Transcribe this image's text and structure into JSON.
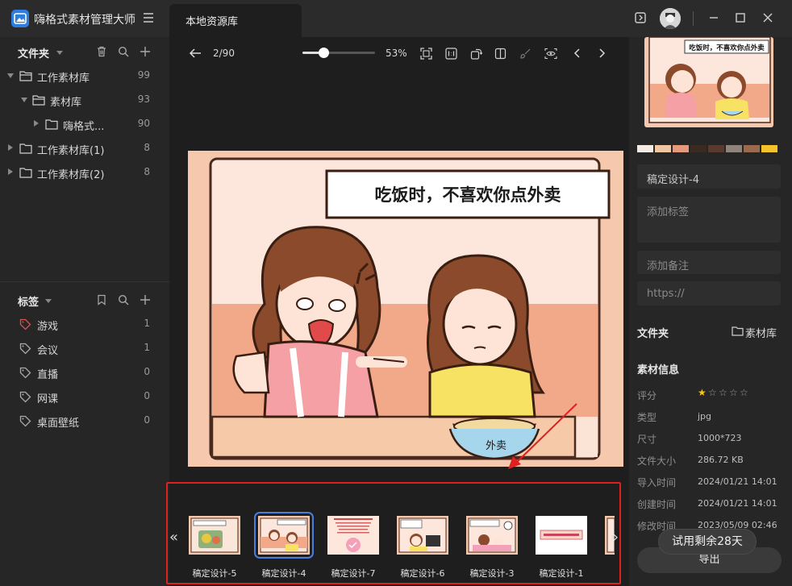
{
  "app": {
    "title": "嗨格式素材管理大师",
    "tab_label": "本地资源库"
  },
  "folders": {
    "section_title": "文件夹",
    "items": [
      {
        "label": "工作素材库",
        "count": "99"
      },
      {
        "label": "素材库",
        "count": "93"
      },
      {
        "label": "嗨格式...",
        "count": "90"
      },
      {
        "label": "工作素材库(1)",
        "count": "8"
      },
      {
        "label": "工作素材库(2)",
        "count": "8"
      }
    ]
  },
  "tags": {
    "section_title": "标签",
    "items": [
      {
        "label": "游戏",
        "count": "1",
        "color": "#e05050"
      },
      {
        "label": "会议",
        "count": "1",
        "color": "#aaaaaa"
      },
      {
        "label": "直播",
        "count": "0",
        "color": "#aaaaaa"
      },
      {
        "label": "网课",
        "count": "0",
        "color": "#aaaaaa"
      },
      {
        "label": "桌面壁纸",
        "count": "0",
        "color": "#aaaaaa"
      }
    ]
  },
  "viewer": {
    "page_indicator": "2/90",
    "zoom_label": "53%",
    "zoom_fraction": 0.53,
    "comic": {
      "caption": "吃饭时，不喜欢你点外卖",
      "bowl_text": "外卖"
    }
  },
  "thumbnails": [
    {
      "label": "稿定设计-5",
      "selected": false
    },
    {
      "label": "稿定设计-4",
      "selected": true
    },
    {
      "label": "稿定设计-7",
      "selected": false
    },
    {
      "label": "稿定设计-6",
      "selected": false
    },
    {
      "label": "稿定设计-3",
      "selected": false
    },
    {
      "label": "稿定设计-1",
      "selected": false
    }
  ],
  "details": {
    "name": "稿定设计-4",
    "tags_placeholder": "添加标签",
    "note_placeholder": "添加备注",
    "url_placeholder": "https://",
    "folder_heading": "文件夹",
    "folder_value": "素材库",
    "info_heading": "素材信息",
    "rating_label": "评分",
    "rating": 1,
    "rating_max": 5,
    "palette": [
      "#f4ece4",
      "#efc6a4",
      "#e59a7e",
      "#3a2a22",
      "#5a3a2e",
      "#8f847c",
      "#9a6a4e",
      "#f4c22a"
    ],
    "info": [
      {
        "key": "类型",
        "value": "jpg"
      },
      {
        "key": "尺寸",
        "value": "1000*723"
      },
      {
        "key": "文件大小",
        "value": "286.72 KB"
      },
      {
        "key": "导入时间",
        "value": "2024/01/21 14:01"
      },
      {
        "key": "创建时间",
        "value": "2024/01/21 14:01"
      },
      {
        "key": "修改时间",
        "value": "2023/05/09 02:46"
      }
    ],
    "export_label": "导出"
  },
  "trial": {
    "label": "试用剩余28天"
  }
}
